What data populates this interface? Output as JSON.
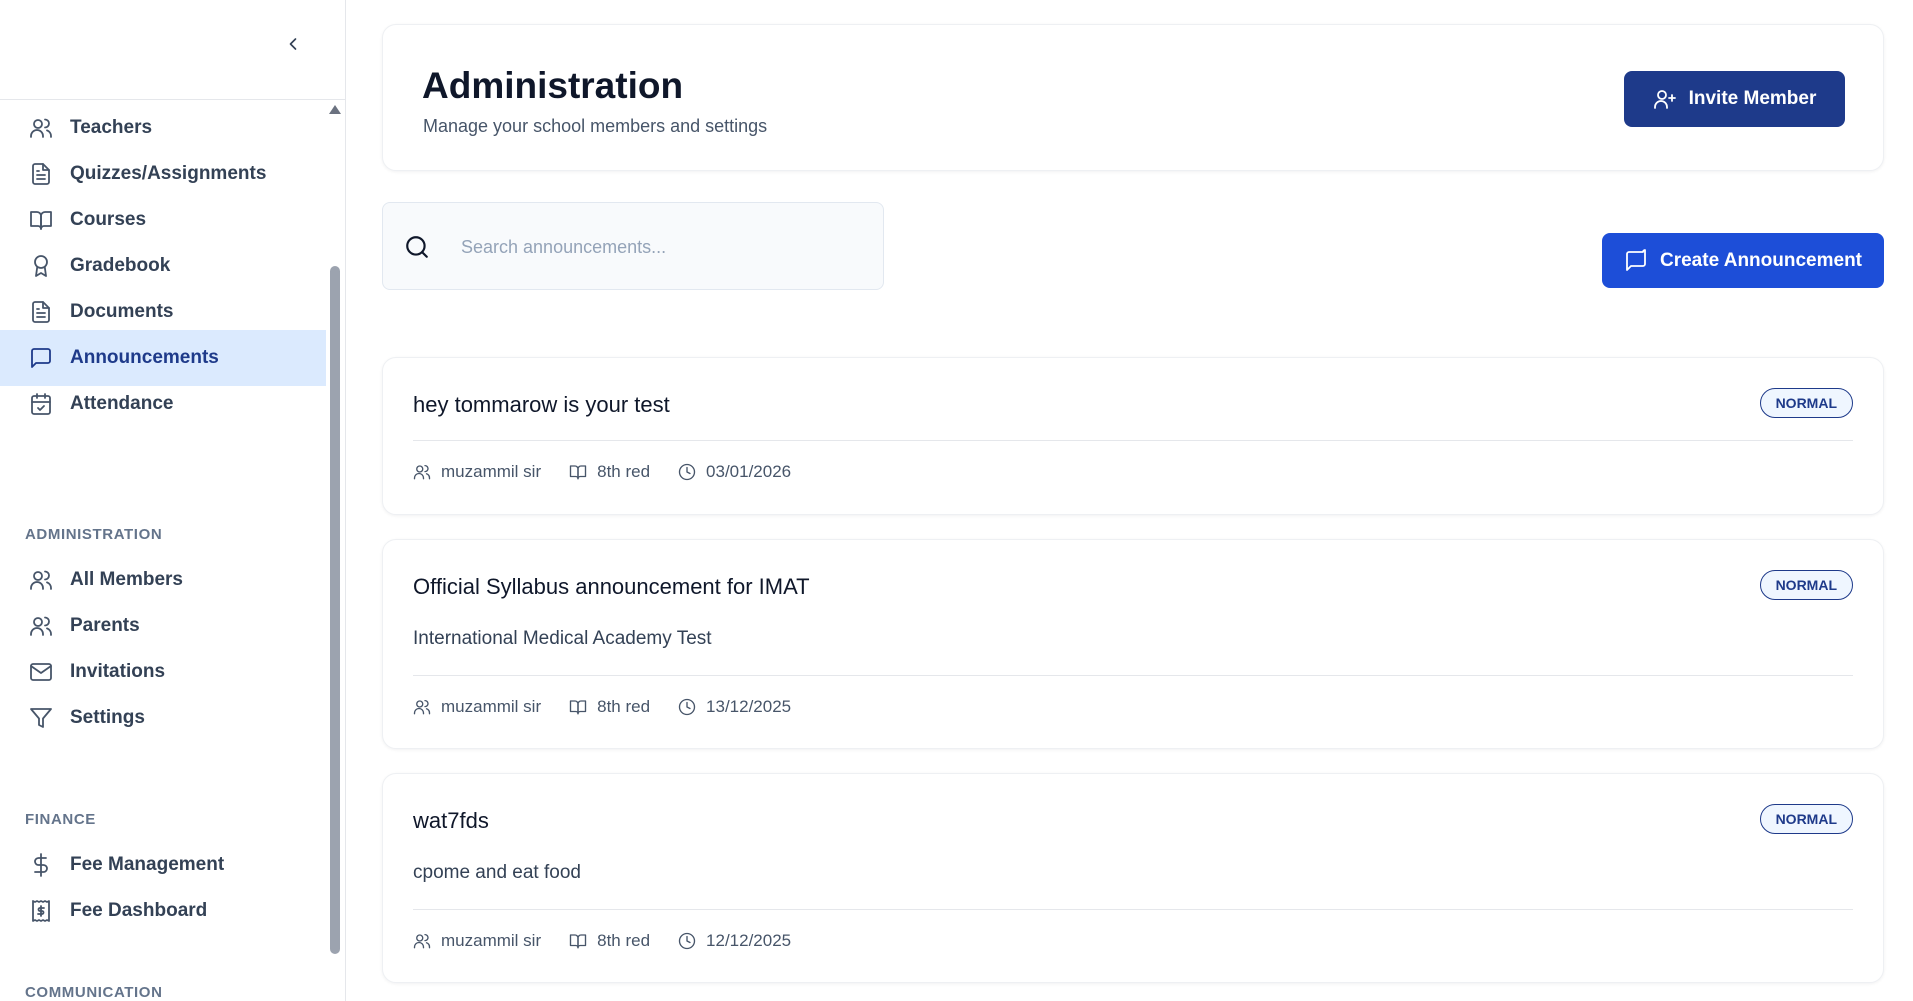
{
  "sidebar": {
    "items": [
      {
        "label": "Teachers",
        "icon": "users-icon"
      },
      {
        "label": "Quizzes/Assignments",
        "icon": "file-text-icon"
      },
      {
        "label": "Courses",
        "icon": "book-open-icon"
      },
      {
        "label": "Gradebook",
        "icon": "award-icon"
      },
      {
        "label": "Documents",
        "icon": "file-text-icon"
      },
      {
        "label": "Announcements",
        "icon": "message-square-icon"
      },
      {
        "label": "Attendance",
        "icon": "calendar-check-icon"
      }
    ],
    "sections": {
      "administration": "ADMINISTRATION",
      "finance": "FINANCE",
      "communication": "COMMUNICATION"
    },
    "admin_items": [
      {
        "label": "All Members",
        "icon": "users-icon"
      },
      {
        "label": "Parents",
        "icon": "users-icon"
      },
      {
        "label": "Invitations",
        "icon": "mail-icon"
      },
      {
        "label": "Settings",
        "icon": "filter-icon"
      }
    ],
    "finance_items": [
      {
        "label": "Fee Management",
        "icon": "dollar-icon"
      },
      {
        "label": "Fee Dashboard",
        "icon": "receipt-icon"
      }
    ],
    "active": "Announcements"
  },
  "header": {
    "title": "Administration",
    "subtitle": "Manage your school members and settings",
    "invite_label": "Invite Member"
  },
  "search": {
    "placeholder": "Search announcements...",
    "value": ""
  },
  "toolbar": {
    "create_label": "Create Announcement"
  },
  "announcements": [
    {
      "title": "hey tommarow is your test",
      "badge": "NORMAL",
      "description": "",
      "author": "muzammil sir",
      "class": "8th red",
      "date": "03/01/2026"
    },
    {
      "title": "Official Syllabus announcement for IMAT",
      "badge": "NORMAL",
      "description": "International Medical Academy Test",
      "author": "muzammil sir",
      "class": "8th red",
      "date": "13/12/2025"
    },
    {
      "title": "wat7fds",
      "badge": "NORMAL",
      "description": "cpome and eat food",
      "author": "muzammil sir",
      "class": "8th red",
      "date": "12/12/2025"
    }
  ],
  "colors": {
    "primary_dark": "#1e3a8a",
    "primary": "#1d4ed8",
    "active_bg": "#dbeafe"
  }
}
